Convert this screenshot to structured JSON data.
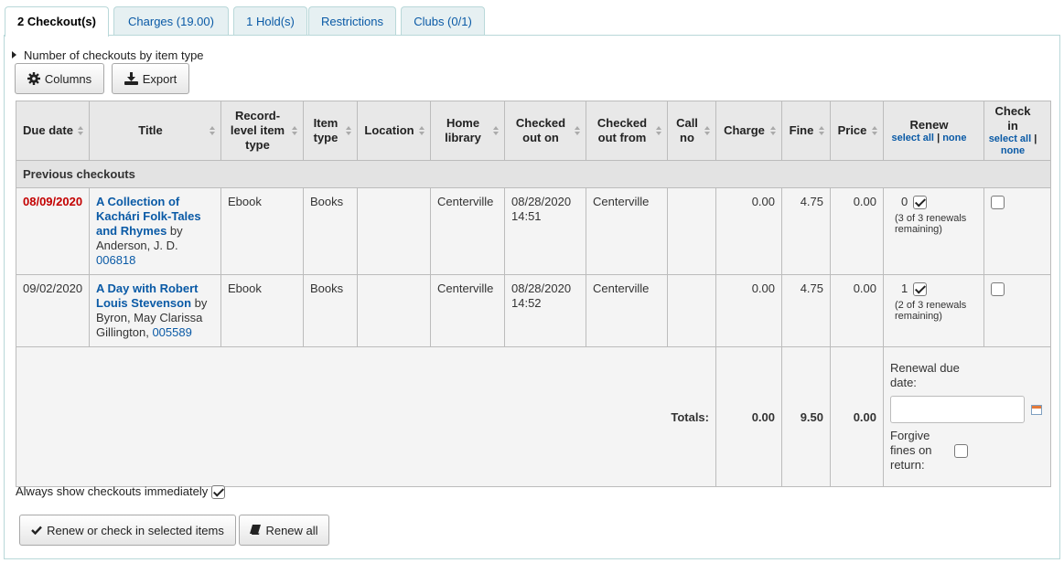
{
  "tabs": [
    {
      "label": "2 Checkout(s)"
    },
    {
      "label": "Charges (19.00)"
    },
    {
      "label": "1 Hold(s)"
    },
    {
      "label": "Restrictions"
    },
    {
      "label": "Clubs (0/1)"
    }
  ],
  "toggler": {
    "label": "Number of checkouts by item type"
  },
  "toolbar": {
    "columns_label": "Columns",
    "export_label": "Export"
  },
  "table": {
    "headers": {
      "due_date": "Due date",
      "title": "Title",
      "record_level_item_type": "Record-level item type",
      "item_type": "Item type",
      "location": "Location",
      "home_library": "Home library",
      "checked_out_on": "Checked out on",
      "checked_out_from": "Checked out from",
      "call_no": "Call no",
      "charge": "Charge",
      "fine": "Fine",
      "price": "Price",
      "renew": "Renew",
      "check_in": "Check in",
      "select_all": "select all",
      "separator": "|",
      "none": "none"
    },
    "group_label": "Previous checkouts",
    "rows": [
      {
        "due_date": "08/09/2020",
        "overdue": true,
        "title": "A Collection of Kachári Folk-Tales and Rhymes",
        "by": " by ",
        "author": "Anderson, J. D.",
        "barcode": "006818",
        "record_level_item_type": "Ebook",
        "item_type": "Books",
        "location": "",
        "home_library": "Centerville",
        "checked_out_on_date": "08/28/2020",
        "checked_out_on_time": "14:51",
        "checked_out_from": "Centerville",
        "call_no": "",
        "charge": "0.00",
        "fine": "4.75",
        "price": "0.00",
        "renewals": "0",
        "renew_checked": true,
        "renewals_note": "(3 of 3 renewals remaining)",
        "checkin_checked": false
      },
      {
        "due_date": "09/02/2020",
        "overdue": false,
        "title": "A Day with Robert Louis Stevenson",
        "by": " by ",
        "author": "Byron, May Clarissa Gillington,",
        "barcode": "005589",
        "record_level_item_type": "Ebook",
        "item_type": "Books",
        "location": "",
        "home_library": "Centerville",
        "checked_out_on_date": "08/28/2020",
        "checked_out_on_time": "14:52",
        "checked_out_from": "Centerville",
        "call_no": "",
        "charge": "0.00",
        "fine": "4.75",
        "price": "0.00",
        "renewals": "1",
        "renew_checked": true,
        "renewals_note": "(2 of 3 renewals remaining)",
        "checkin_checked": false
      }
    ],
    "totals": {
      "label": "Totals:",
      "charge": "0.00",
      "fine": "9.50",
      "price": "0.00"
    },
    "renewal_due_date_label": "Renewal due date:",
    "renewal_due_date_value": "",
    "forgive_label": "Forgive fines on return:"
  },
  "always_show": {
    "label": "Always show checkouts immediately",
    "checked": true
  },
  "actions": {
    "renew_checkin_label": "Renew or check in selected items",
    "renew_all_label": "Renew all"
  },
  "colors": {
    "link": "#0a5aa6",
    "overdue": "#c30000",
    "tab_bg": "#e6f0f2",
    "tab_border": "#b9d8d9"
  }
}
